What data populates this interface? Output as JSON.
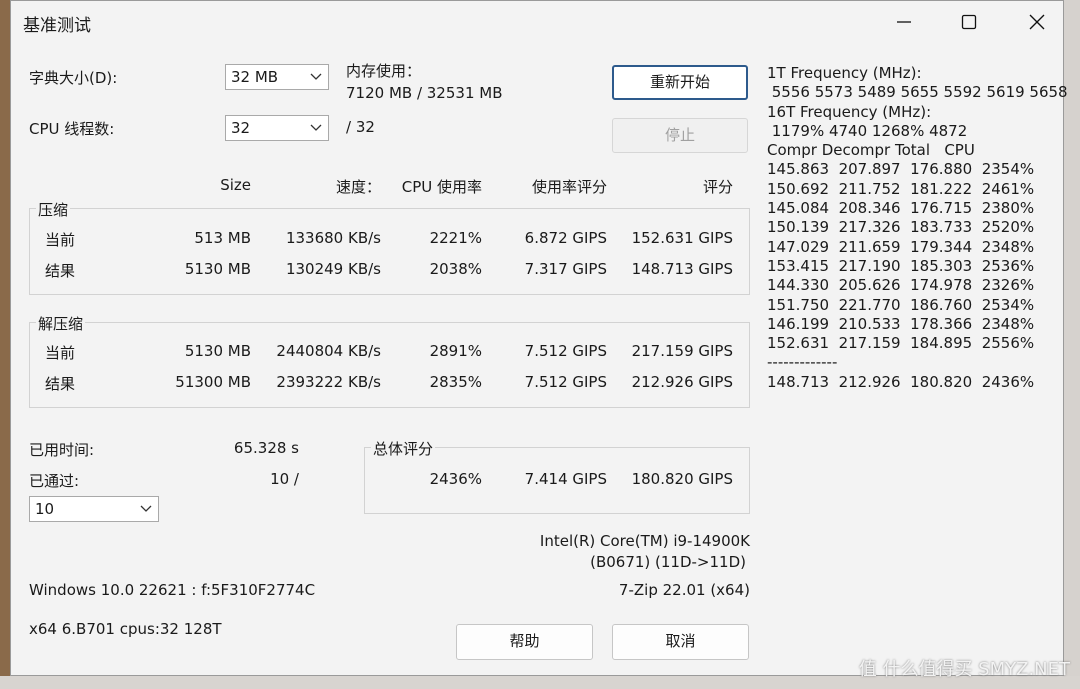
{
  "window": {
    "title": "基准测试"
  },
  "settings": {
    "dict_label": "字典大小(D):",
    "dict_value": "32 MB",
    "threads_label": "CPU 线程数:",
    "threads_value": "32",
    "threads_max": "/ 32",
    "mem_label": "内存使用：",
    "mem_value": "7120 MB / 32531 MB"
  },
  "buttons": {
    "restart": "重新开始",
    "stop": "停止",
    "help": "帮助",
    "cancel": "取消"
  },
  "headers": {
    "size": "Size",
    "speed": "速度：",
    "cpu": "CPU 使用率",
    "usage_rating": "使用率评分",
    "rating": "评分"
  },
  "compress": {
    "title": "压缩",
    "current": {
      "label": "当前",
      "size": "513 MB",
      "speed": "133680 KB/s",
      "cpu": "2221%",
      "usage": "6.872 GIPS",
      "rating": "152.631 GIPS"
    },
    "result": {
      "label": "结果",
      "size": "5130 MB",
      "speed": "130249 KB/s",
      "cpu": "2038%",
      "usage": "7.317 GIPS",
      "rating": "148.713 GIPS"
    }
  },
  "decompress": {
    "title": "解压缩",
    "current": {
      "label": "当前",
      "size": "5130 MB",
      "speed": "2440804 KB/s",
      "cpu": "2891%",
      "usage": "7.512 GIPS",
      "rating": "217.159 GIPS"
    },
    "result": {
      "label": "结果",
      "size": "51300 MB",
      "speed": "2393222 KB/s",
      "cpu": "2835%",
      "usage": "7.512 GIPS",
      "rating": "212.926 GIPS"
    }
  },
  "elapsed": {
    "label": "已用时间:",
    "value": "65.328 s"
  },
  "passed": {
    "label": "已通过:",
    "value": "10 /",
    "combo": "10"
  },
  "total": {
    "title": "总体评分",
    "cpu": "2436%",
    "usage": "7.414 GIPS",
    "rating": "180.820 GIPS"
  },
  "cpu_info": {
    "line1": "Intel(R) Core(TM) i9-14900K",
    "line2": "(B0671) (11D->11D)"
  },
  "system": {
    "os": "Windows 10.0 22621 :  f:5F310F2774C",
    "version": "7-Zip 22.01 (x64)",
    "arch": "x64 6.B701 cpus:32 128T"
  },
  "log": [
    "1T Frequency (MHz):",
    " 5556 5573 5489 5655 5592 5619 5658",
    "16T Frequency (MHz):",
    " 1179% 4740 1268% 4872",
    "Compr Decompr Total   CPU",
    "145.863  207.897  176.880  2354%",
    "150.692  211.752  181.222  2461%",
    "145.084  208.346  176.715  2380%",
    "150.139  217.326  183.733  2520%",
    "147.029  211.659  179.344  2348%",
    "153.415  217.190  185.303  2536%",
    "144.330  205.626  174.978  2326%",
    "151.750  221.770  186.760  2534%",
    "146.199  210.533  178.366  2348%",
    "152.631  217.159  184.895  2556%",
    "-------------",
    "148.713  212.926  180.820  2436%"
  ],
  "watermark": "值 什么值得买 SMYZ.NET"
}
